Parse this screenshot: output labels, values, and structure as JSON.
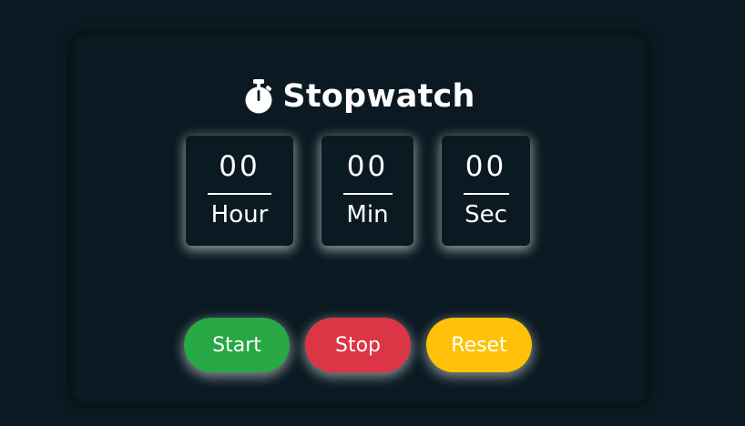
{
  "app": {
    "title": "Stopwatch",
    "title_icon": "stopwatch-icon"
  },
  "timer": {
    "hours": {
      "value": "00",
      "label": "Hour"
    },
    "minutes": {
      "value": "00",
      "label": "Min"
    },
    "seconds": {
      "value": "00",
      "label": "Sec"
    }
  },
  "controls": {
    "start_label": "Start",
    "stop_label": "Stop",
    "reset_label": "Reset"
  },
  "colors": {
    "background": "#0b1a22",
    "start": "#28a745",
    "stop": "#dc3545",
    "reset": "#ffc107",
    "text": "#ffffff"
  }
}
